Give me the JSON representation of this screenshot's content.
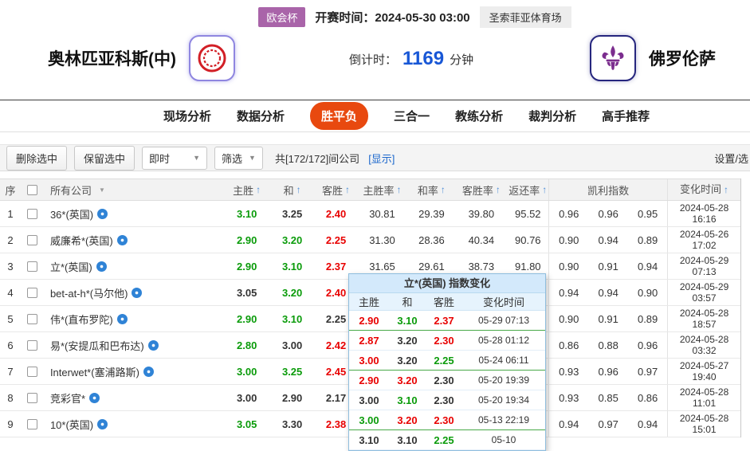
{
  "colors": {
    "odds_up": "#0a9b0a",
    "odds_down": "#e80000",
    "accent_tab": "#e8490f",
    "badge_purple": "#a964a9",
    "countdown_blue": "#1857d6",
    "link": "#1a66cc",
    "sort_arrow": "#4f8fd8",
    "popup_border": "#8fbede",
    "popup_header_bg": "#d3e9fb"
  },
  "icons": {
    "sort_asc": "↑",
    "caret_down": "▼"
  },
  "header": {
    "league_badge": "欧会杯",
    "kickoff_label": "开赛时间：",
    "kickoff_time": "2024-05-30 03:00",
    "stadium": "圣索菲亚体育场",
    "home_team": "奥林匹亚科斯(中)",
    "away_team": "佛罗伦萨",
    "countdown_label": "倒计时：",
    "countdown_value": "1169",
    "countdown_unit": "分钟"
  },
  "nav": {
    "tabs": [
      {
        "key": "live-analysis",
        "label": "现场分析",
        "active": false
      },
      {
        "key": "data-analysis",
        "label": "数据分析",
        "active": false
      },
      {
        "key": "win-draw-loss",
        "label": "胜平负",
        "active": true
      },
      {
        "key": "three-in-one",
        "label": "三合一",
        "active": false
      },
      {
        "key": "coach-analysis",
        "label": "教练分析",
        "active": false
      },
      {
        "key": "referee-analysis",
        "label": "裁判分析",
        "active": false
      },
      {
        "key": "expert-picks",
        "label": "高手推荐",
        "active": false
      }
    ]
  },
  "toolbar": {
    "delete_selected": "删除选中",
    "keep_selected": "保留选中",
    "instant": "即时",
    "filter": "筛选",
    "company_count": "共[172/172]间公司",
    "show_link": "[显示]",
    "settings": "设置/选"
  },
  "table": {
    "headers": {
      "seq": "序",
      "company": "所有公司",
      "home": "主胜",
      "draw": "和",
      "away": "客胜",
      "home_rate": "主胜率",
      "draw_rate": "和率",
      "away_rate": "客胜率",
      "return_rate": "返还率",
      "kelly": "凯利指数",
      "change_time": "变化时间"
    },
    "rows": [
      {
        "index": "1",
        "company": "36*(英国)",
        "odds": [
          "3.10",
          "3.25",
          "2.40"
        ],
        "odds_colors": [
          "g",
          "k",
          "r"
        ],
        "rates": [
          "30.81",
          "29.39",
          "39.80",
          "95.52"
        ],
        "kelly": [
          "0.96",
          "0.96",
          "0.95"
        ],
        "change_date": "2024-05-28",
        "change_time": "16:16"
      },
      {
        "index": "2",
        "company": "威廉希*(英国)",
        "odds": [
          "2.90",
          "3.20",
          "2.25"
        ],
        "odds_colors": [
          "g",
          "g",
          "r"
        ],
        "rates": [
          "31.30",
          "28.36",
          "40.34",
          "90.76"
        ],
        "kelly": [
          "0.90",
          "0.94",
          "0.89"
        ],
        "change_date": "2024-05-26",
        "change_time": "17:02"
      },
      {
        "index": "3",
        "company": "立*(英国)",
        "odds": [
          "2.90",
          "3.10",
          "2.37"
        ],
        "odds_colors": [
          "g",
          "g",
          "r"
        ],
        "rates": [
          "31.65",
          "29.61",
          "38.73",
          "91.80"
        ],
        "kelly": [
          "0.90",
          "0.91",
          "0.94"
        ],
        "change_date": "2024-05-29",
        "change_time": "07:13"
      },
      {
        "index": "4",
        "company": "bet-at-h*(马尔他)",
        "odds": [
          "3.05",
          "3.20",
          "2.40"
        ],
        "odds_colors": [
          "k",
          "g",
          "r"
        ],
        "rates": [
          "",
          "",
          "",
          ""
        ],
        "kelly": [
          "0.94",
          "0.94",
          "0.90"
        ],
        "change_date": "2024-05-29",
        "change_time": "03:57"
      },
      {
        "index": "5",
        "company": "伟*(直布罗陀)",
        "odds": [
          "2.90",
          "3.10",
          "2.25"
        ],
        "odds_colors": [
          "g",
          "g",
          "k"
        ],
        "rates": [
          "",
          "",
          "",
          ""
        ],
        "kelly": [
          "0.90",
          "0.91",
          "0.89"
        ],
        "change_date": "2024-05-28",
        "change_time": "18:57"
      },
      {
        "index": "6",
        "company": "易*(安提瓜和巴布达)",
        "odds": [
          "2.80",
          "3.00",
          "2.42"
        ],
        "odds_colors": [
          "g",
          "k",
          "r"
        ],
        "rates": [
          "",
          "",
          "",
          ""
        ],
        "kelly": [
          "0.86",
          "0.88",
          "0.96"
        ],
        "change_date": "2024-05-28",
        "change_time": "03:32"
      },
      {
        "index": "7",
        "company": "Interwet*(塞浦路斯)",
        "odds": [
          "3.00",
          "3.25",
          "2.45"
        ],
        "odds_colors": [
          "g",
          "g",
          "r"
        ],
        "rates": [
          "",
          "",
          "",
          ""
        ],
        "kelly": [
          "0.93",
          "0.96",
          "0.97"
        ],
        "change_date": "2024-05-27",
        "change_time": "19:40"
      },
      {
        "index": "8",
        "company": "竞彩官*",
        "odds": [
          "3.00",
          "2.90",
          "2.17"
        ],
        "odds_colors": [
          "k",
          "k",
          "k"
        ],
        "rates": [
          "",
          "",
          "",
          ""
        ],
        "kelly": [
          "0.93",
          "0.85",
          "0.86"
        ],
        "change_date": "2024-05-28",
        "change_time": "11:01"
      },
      {
        "index": "9",
        "company": "10*(英国)",
        "odds": [
          "3.05",
          "3.30",
          "2.38"
        ],
        "odds_colors": [
          "g",
          "k",
          "r"
        ],
        "rates": [
          "",
          "",
          "",
          ""
        ],
        "kelly": [
          "0.94",
          "0.97",
          "0.94"
        ],
        "change_date": "2024-05-28",
        "change_time": "15:01"
      }
    ]
  },
  "popup": {
    "title": "立*(英国) 指数变化",
    "headers": [
      "主胜",
      "和",
      "客胜",
      "变化时间"
    ],
    "rows": [
      {
        "values": [
          "2.90",
          "3.10",
          "2.37"
        ],
        "colors": [
          "r",
          "g",
          "r"
        ],
        "time": "05-29 07:13",
        "divider": true
      },
      {
        "values": [
          "2.87",
          "3.20",
          "2.30"
        ],
        "colors": [
          "r",
          "k",
          "r"
        ],
        "time": "05-28 01:12",
        "divider": false
      },
      {
        "values": [
          "3.00",
          "3.20",
          "2.25"
        ],
        "colors": [
          "r",
          "k",
          "g"
        ],
        "time": "05-24 06:11",
        "divider": true
      },
      {
        "values": [
          "2.90",
          "3.20",
          "2.30"
        ],
        "colors": [
          "r",
          "r",
          "k"
        ],
        "time": "05-20 19:39",
        "divider": false
      },
      {
        "values": [
          "3.00",
          "3.10",
          "2.30"
        ],
        "colors": [
          "k",
          "g",
          "k"
        ],
        "time": "05-20 19:34",
        "divider": false
      },
      {
        "values": [
          "3.00",
          "3.20",
          "2.30"
        ],
        "colors": [
          "g",
          "r",
          "r"
        ],
        "time": "05-13 22:19",
        "divider": true
      },
      {
        "values": [
          "3.10",
          "3.10",
          "2.25"
        ],
        "colors": [
          "k",
          "k",
          "g"
        ],
        "time": "05-10",
        "divider": false
      }
    ]
  }
}
